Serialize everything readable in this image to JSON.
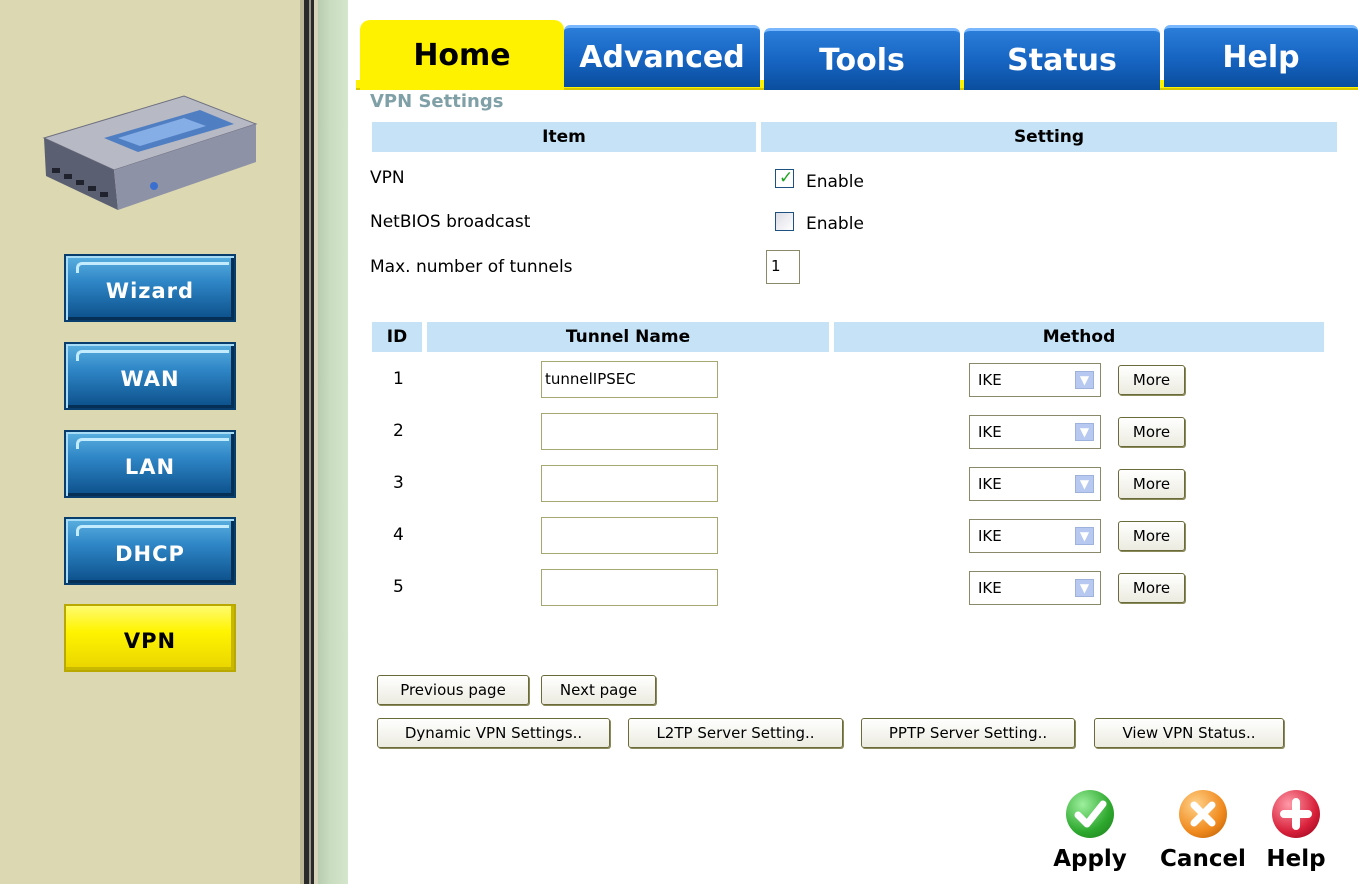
{
  "tabs": [
    {
      "label": "Home",
      "active": true
    },
    {
      "label": "Advanced",
      "active": false
    },
    {
      "label": "Tools",
      "active": false
    },
    {
      "label": "Status",
      "active": false
    },
    {
      "label": "Help",
      "active": false
    }
  ],
  "sidebar": {
    "items": [
      {
        "label": "Wizard"
      },
      {
        "label": "WAN"
      },
      {
        "label": "LAN"
      },
      {
        "label": "DHCP"
      },
      {
        "label": "VPN",
        "active": true
      }
    ]
  },
  "page_title": "VPN Settings",
  "settings_table": {
    "headers": {
      "item": "Item",
      "setting": "Setting"
    },
    "vpn_label": "VPN",
    "vpn_enable_label": "Enable",
    "vpn_enabled": true,
    "netbios_label": "NetBIOS broadcast",
    "netbios_enable_label": "Enable",
    "netbios_enabled": false,
    "max_tunnels_label": "Max. number of tunnels",
    "max_tunnels_value": "1"
  },
  "tunnel_table": {
    "headers": {
      "id": "ID",
      "name": "Tunnel Name",
      "method": "Method"
    },
    "rows": [
      {
        "id": "1",
        "name": "tunnelIPSEC",
        "method": "IKE",
        "more": "More"
      },
      {
        "id": "2",
        "name": "",
        "method": "IKE",
        "more": "More"
      },
      {
        "id": "3",
        "name": "",
        "method": "IKE",
        "more": "More"
      },
      {
        "id": "4",
        "name": "",
        "method": "IKE",
        "more": "More"
      },
      {
        "id": "5",
        "name": "",
        "method": "IKE",
        "more": "More"
      }
    ]
  },
  "paging": {
    "previous": "Previous page",
    "next": "Next page"
  },
  "links": {
    "dynamic_vpn": "Dynamic VPN Settings..",
    "l2tp": "L2TP Server Setting..",
    "pptp": "PPTP Server Setting..",
    "view_status": "View VPN Status.."
  },
  "actions": {
    "apply": "Apply",
    "cancel": "Cancel",
    "help": "Help"
  },
  "colors": {
    "tab_active": "#fff200",
    "tab_inactive": "#1765c3",
    "header_bg": "#c6e2f6",
    "sidebar_bg": "#dcd8b2",
    "apply_green": "#2ea82e",
    "cancel_orange": "#f08a1e",
    "help_red": "#d8203a"
  }
}
